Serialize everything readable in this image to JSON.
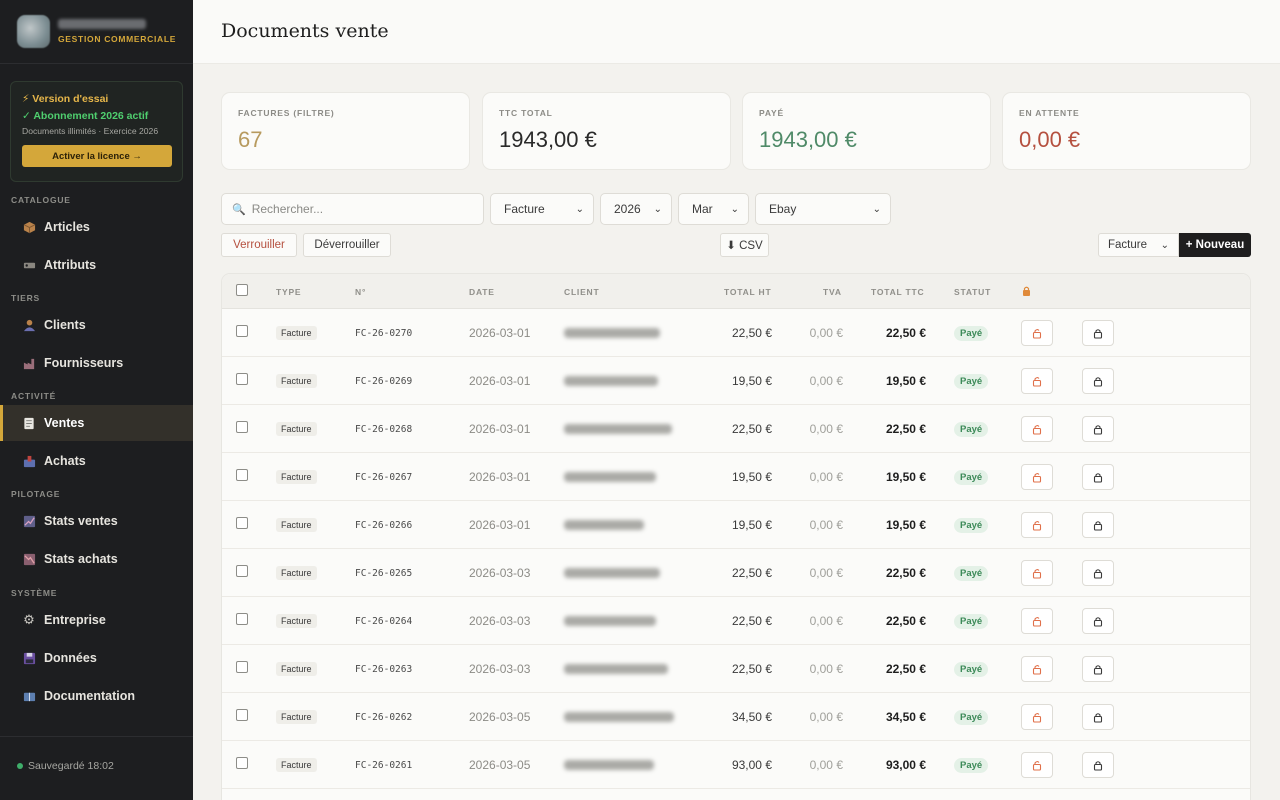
{
  "brand": {
    "subtitle": "GESTION COMMERCIALE"
  },
  "trial": {
    "line1": "⚡ Version d'essai",
    "line2": "✓ Abonnement 2026 actif",
    "line3": "Documents illimités · Exercice 2026",
    "button": "Activer la licence →"
  },
  "sidebar": {
    "sections": {
      "catalogue": "CATALOGUE",
      "tiers": "TIERS",
      "activite": "ACTIVITÉ",
      "pilotage": "PILOTAGE",
      "systeme": "SYSTÈME"
    },
    "items": {
      "articles": "Articles",
      "attributs": "Attributs",
      "clients": "Clients",
      "fournisseurs": "Fournisseurs",
      "ventes": "Ventes",
      "achats": "Achats",
      "stats_ventes": "Stats ventes",
      "stats_achats": "Stats achats",
      "entreprise": "Entreprise",
      "donnees": "Données",
      "documentation": "Documentation"
    },
    "saved": "Sauvegardé 18:02"
  },
  "page": {
    "title": "Documents vente"
  },
  "stats": {
    "factures_label": "FACTURES (FILTRE)",
    "factures_value": "67",
    "ttc_label": "TTC TOTAL",
    "ttc_value": "1943,00 €",
    "paye_label": "PAYÉ",
    "paye_value": "1943,00 €",
    "attente_label": "EN ATTENTE",
    "attente_value": "0,00 €"
  },
  "filters": {
    "search_placeholder": "Rechercher...",
    "type": "Facture",
    "year": "2026",
    "month": "Mar",
    "channel": "Ebay",
    "lock": "Verrouiller",
    "unlock": "Déverrouiller",
    "csv": "⬇ CSV",
    "new_type": "Facture",
    "new": "+ Nouveau"
  },
  "table": {
    "headers": {
      "type": "TYPE",
      "num": "N°",
      "date": "DATE",
      "client": "CLIENT",
      "ht": "TOTAL HT",
      "tva": "TVA",
      "ttc": "TOTAL TTC",
      "statut": "STATUT"
    },
    "rows": [
      {
        "type": "Facture",
        "num": "FC-26-0270",
        "date": "2026-03-01",
        "ht": "22,50 €",
        "tva": "0,00 €",
        "ttc": "22,50 €",
        "statut": "Payé"
      },
      {
        "type": "Facture",
        "num": "FC-26-0269",
        "date": "2026-03-01",
        "ht": "19,50 €",
        "tva": "0,00 €",
        "ttc": "19,50 €",
        "statut": "Payé"
      },
      {
        "type": "Facture",
        "num": "FC-26-0268",
        "date": "2026-03-01",
        "ht": "22,50 €",
        "tva": "0,00 €",
        "ttc": "22,50 €",
        "statut": "Payé"
      },
      {
        "type": "Facture",
        "num": "FC-26-0267",
        "date": "2026-03-01",
        "ht": "19,50 €",
        "tva": "0,00 €",
        "ttc": "19,50 €",
        "statut": "Payé"
      },
      {
        "type": "Facture",
        "num": "FC-26-0266",
        "date": "2026-03-01",
        "ht": "19,50 €",
        "tva": "0,00 €",
        "ttc": "19,50 €",
        "statut": "Payé"
      },
      {
        "type": "Facture",
        "num": "FC-26-0265",
        "date": "2026-03-03",
        "ht": "22,50 €",
        "tva": "0,00 €",
        "ttc": "22,50 €",
        "statut": "Payé"
      },
      {
        "type": "Facture",
        "num": "FC-26-0264",
        "date": "2026-03-03",
        "ht": "22,50 €",
        "tva": "0,00 €",
        "ttc": "22,50 €",
        "statut": "Payé"
      },
      {
        "type": "Facture",
        "num": "FC-26-0263",
        "date": "2026-03-03",
        "ht": "22,50 €",
        "tva": "0,00 €",
        "ttc": "22,50 €",
        "statut": "Payé"
      },
      {
        "type": "Facture",
        "num": "FC-26-0262",
        "date": "2026-03-05",
        "ht": "34,50 €",
        "tva": "0,00 €",
        "ttc": "34,50 €",
        "statut": "Payé"
      },
      {
        "type": "Facture",
        "num": "FC-26-0261",
        "date": "2026-03-05",
        "ht": "93,00 €",
        "tva": "0,00 €",
        "ttc": "93,00 €",
        "statut": "Payé"
      }
    ]
  },
  "colors": {
    "accent": "#d4a73a",
    "factures": "#b79a5e",
    "ttc": "#2a2a2a",
    "paye": "#4f8a68",
    "attente": "#b5503f",
    "sidebar_bg": "#1d1e20"
  }
}
